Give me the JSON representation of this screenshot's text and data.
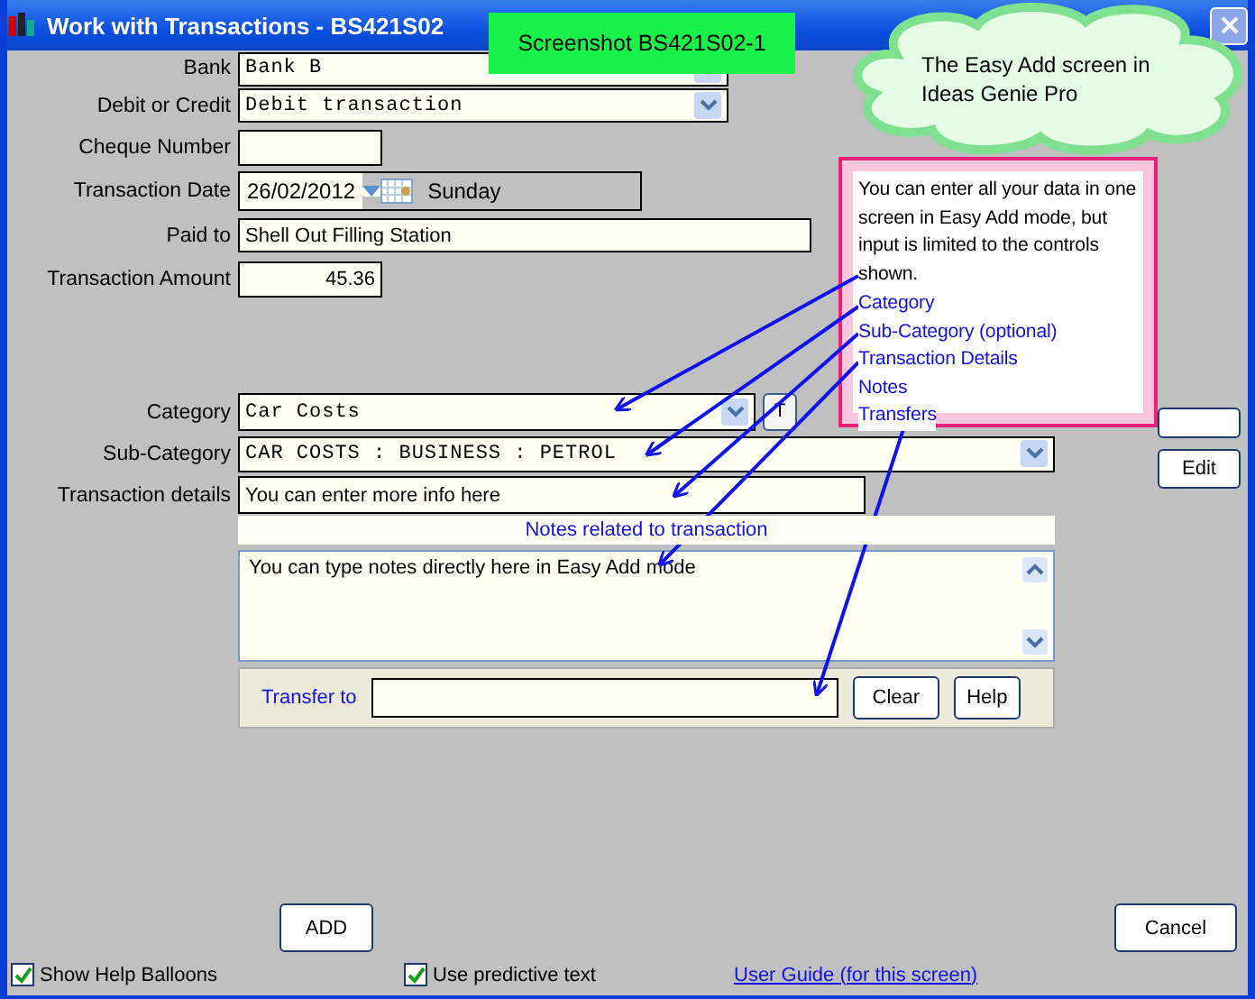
{
  "window": {
    "title": "Work with Transactions - BS421S02"
  },
  "screenshot_label": "Screenshot BS421S02-1",
  "cloud_note": "The Easy Add screen in Ideas Genie Pro",
  "callout": {
    "text": "You can enter all your data in one screen in Easy Add mode, but input is limited to the controls shown.",
    "links": [
      "Category",
      "Sub-Category (optional)",
      "Transaction Details",
      "Notes",
      "Transfers"
    ]
  },
  "fields": [
    {
      "kind": "select",
      "label": "Bank",
      "value": "Bank B"
    },
    {
      "kind": "select",
      "label": "Debit or Credit",
      "value": "Debit transaction"
    },
    {
      "kind": "short",
      "label": "Cheque Number"
    },
    {
      "kind": "date",
      "label": "Transaction Date",
      "value": "26/02/2012",
      "day": "Sunday"
    },
    {
      "kind": "text",
      "label": "Paid to",
      "value": "Shell Out Filling Station"
    },
    {
      "kind": "amount",
      "label": "Transaction Amount",
      "value": "45.36"
    }
  ],
  "category": {
    "label": "Category",
    "value": "Car Costs",
    "button": "T"
  },
  "sub_category": {
    "label": "Sub-Category",
    "value": "CAR COSTS : BUSINESS : PETROL"
  },
  "details": {
    "label": "Transaction details",
    "value": "You can enter more info here"
  },
  "notes": {
    "header": "Notes related to transaction",
    "value": "You can type notes directly here in Easy Add mode"
  },
  "transfer": {
    "label": "Transfer to",
    "buttons": [
      "Clear",
      "Help"
    ]
  },
  "side_buttons": [
    "Edit"
  ],
  "bottom_buttons": [
    "ADD",
    "Cancel"
  ],
  "options": [
    {
      "label": "Show Help Balloons",
      "checked": true
    },
    {
      "label": "Use predictive text",
      "checked": true
    }
  ],
  "help_link": "User Guide (for this screen)"
}
